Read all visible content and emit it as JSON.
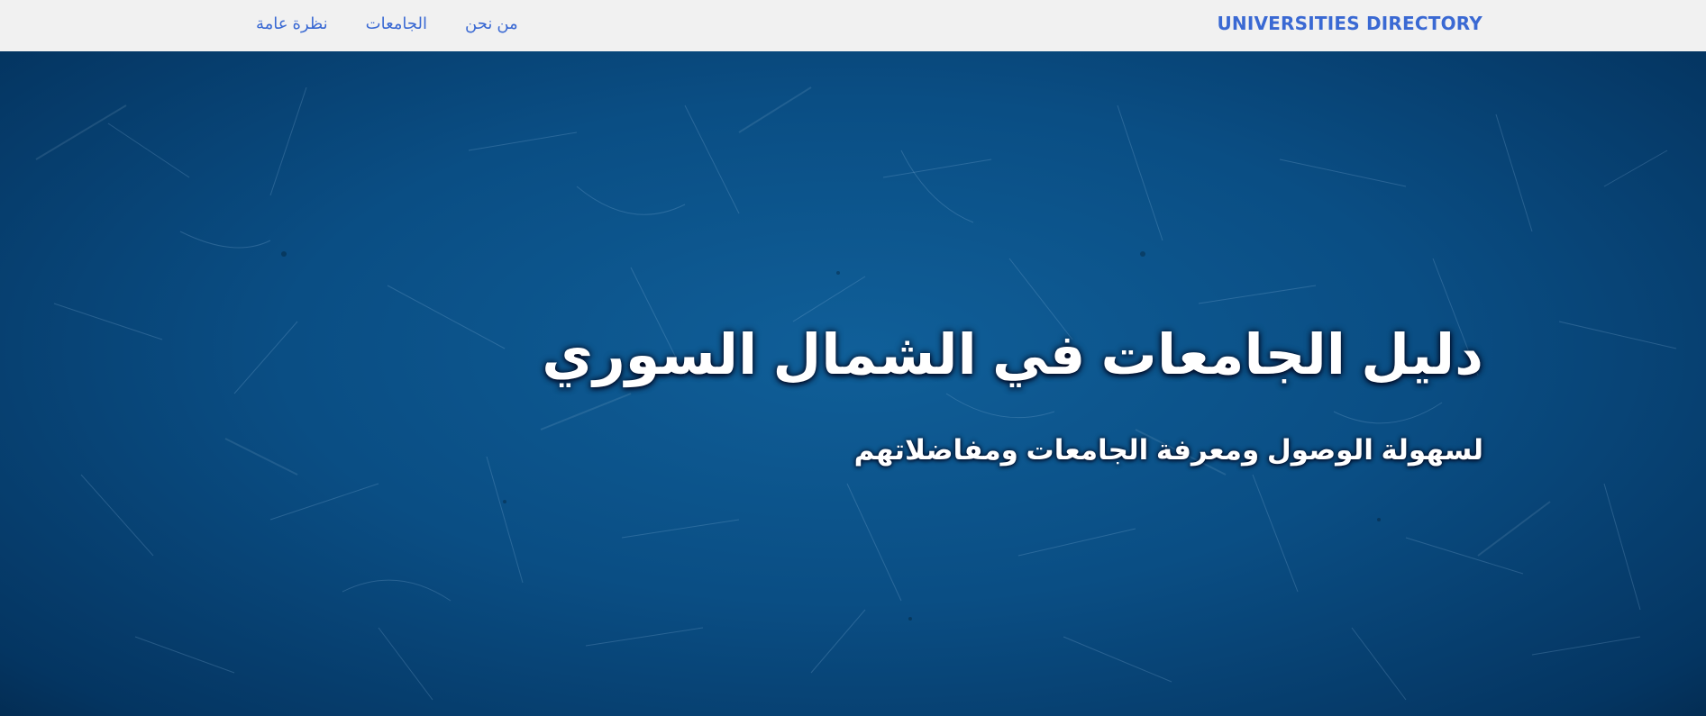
{
  "navbar": {
    "brand": "UNIVERSITIES DIRECTORY",
    "links": [
      {
        "label": "نظرة عامة"
      },
      {
        "label": "الجامعات"
      },
      {
        "label": "من نحن"
      }
    ]
  },
  "hero": {
    "title": "دليل الجامعات في الشمال السوري",
    "subtitle": "لسهولة الوصول ومعرفة الجامعات ومفاضلاتهم"
  },
  "colors": {
    "accent": "#3a69d3",
    "navbar_bg": "#f1f1f1",
    "hero_bg": "#0b4a7e",
    "hero_text": "#ffffff"
  }
}
